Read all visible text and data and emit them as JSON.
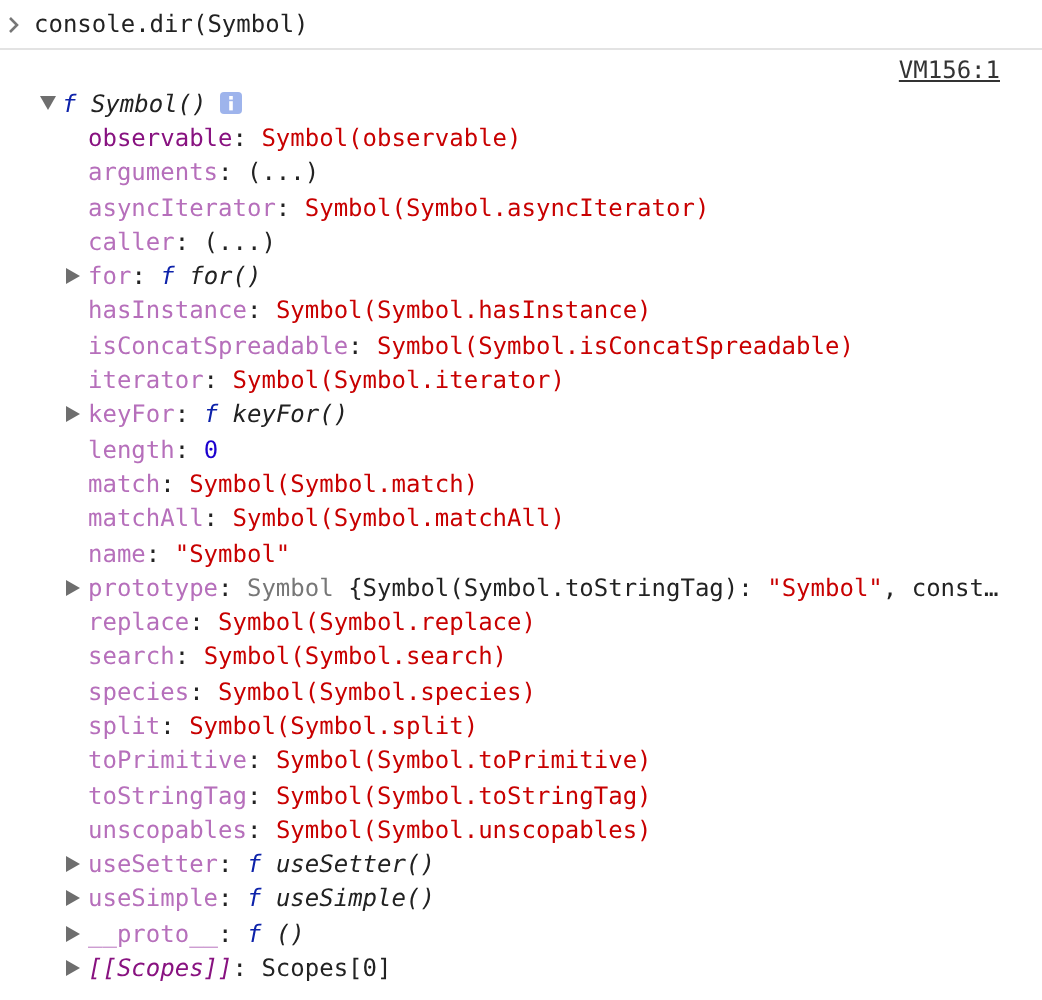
{
  "input": {
    "command": "console.dir(Symbol)"
  },
  "output": {
    "source": "VM156:1",
    "root": {
      "expanded": true,
      "parts": [
        {
          "kind": "fn-keyword",
          "text": "f"
        },
        {
          "kind": "fn-name",
          "text": " Symbol()"
        }
      ]
    },
    "properties": [
      {
        "expandable": false,
        "parts": [
          {
            "kind": "key",
            "text": "observable"
          },
          {
            "kind": "punct",
            "text": ": "
          },
          {
            "kind": "symbol",
            "text": "Symbol(observable)"
          }
        ]
      },
      {
        "expandable": false,
        "parts": [
          {
            "kind": "key-dim",
            "text": "arguments"
          },
          {
            "kind": "punct",
            "text": ": (...)"
          }
        ]
      },
      {
        "expandable": false,
        "parts": [
          {
            "kind": "key-dim",
            "text": "asyncIterator"
          },
          {
            "kind": "punct",
            "text": ": "
          },
          {
            "kind": "symbol",
            "text": "Symbol(Symbol.asyncIterator)"
          }
        ]
      },
      {
        "expandable": false,
        "parts": [
          {
            "kind": "key-dim",
            "text": "caller"
          },
          {
            "kind": "punct",
            "text": ": (...)"
          }
        ]
      },
      {
        "expandable": true,
        "parts": [
          {
            "kind": "key-dim",
            "text": "for"
          },
          {
            "kind": "punct",
            "text": ": "
          },
          {
            "kind": "fn-keyword",
            "text": "f"
          },
          {
            "kind": "fn-name",
            "text": " for()"
          }
        ]
      },
      {
        "expandable": false,
        "parts": [
          {
            "kind": "key-dim",
            "text": "hasInstance"
          },
          {
            "kind": "punct",
            "text": ": "
          },
          {
            "kind": "symbol",
            "text": "Symbol(Symbol.hasInstance)"
          }
        ]
      },
      {
        "expandable": false,
        "parts": [
          {
            "kind": "key-dim",
            "text": "isConcatSpreadable"
          },
          {
            "kind": "punct",
            "text": ": "
          },
          {
            "kind": "symbol",
            "text": "Symbol(Symbol.isConcatSpreadable)"
          }
        ]
      },
      {
        "expandable": false,
        "parts": [
          {
            "kind": "key-dim",
            "text": "iterator"
          },
          {
            "kind": "punct",
            "text": ": "
          },
          {
            "kind": "symbol",
            "text": "Symbol(Symbol.iterator)"
          }
        ]
      },
      {
        "expandable": true,
        "parts": [
          {
            "kind": "key-dim",
            "text": "keyFor"
          },
          {
            "kind": "punct",
            "text": ": "
          },
          {
            "kind": "fn-keyword",
            "text": "f"
          },
          {
            "kind": "fn-name",
            "text": " keyFor()"
          }
        ]
      },
      {
        "expandable": false,
        "parts": [
          {
            "kind": "key-dim",
            "text": "length"
          },
          {
            "kind": "punct",
            "text": ": "
          },
          {
            "kind": "number",
            "text": "0"
          }
        ]
      },
      {
        "expandable": false,
        "parts": [
          {
            "kind": "key-dim",
            "text": "match"
          },
          {
            "kind": "punct",
            "text": ": "
          },
          {
            "kind": "symbol",
            "text": "Symbol(Symbol.match)"
          }
        ]
      },
      {
        "expandable": false,
        "parts": [
          {
            "kind": "key-dim",
            "text": "matchAll"
          },
          {
            "kind": "punct",
            "text": ": "
          },
          {
            "kind": "symbol",
            "text": "Symbol(Symbol.matchAll)"
          }
        ]
      },
      {
        "expandable": false,
        "parts": [
          {
            "kind": "key-dim",
            "text": "name"
          },
          {
            "kind": "punct",
            "text": ": "
          },
          {
            "kind": "string",
            "text": "\"Symbol\""
          }
        ]
      },
      {
        "expandable": true,
        "parts": [
          {
            "kind": "key-dim",
            "text": "prototype"
          },
          {
            "kind": "punct",
            "text": ": "
          },
          {
            "kind": "class",
            "text": "Symbol"
          },
          {
            "kind": "punct",
            "text": " {Symbol(Symbol.toStringTag): "
          },
          {
            "kind": "string",
            "text": "\"Symbol\""
          },
          {
            "kind": "punct",
            "text": ", const…"
          }
        ]
      },
      {
        "expandable": false,
        "parts": [
          {
            "kind": "key-dim",
            "text": "replace"
          },
          {
            "kind": "punct",
            "text": ": "
          },
          {
            "kind": "symbol",
            "text": "Symbol(Symbol.replace)"
          }
        ]
      },
      {
        "expandable": false,
        "parts": [
          {
            "kind": "key-dim",
            "text": "search"
          },
          {
            "kind": "punct",
            "text": ": "
          },
          {
            "kind": "symbol",
            "text": "Symbol(Symbol.search)"
          }
        ]
      },
      {
        "expandable": false,
        "parts": [
          {
            "kind": "key-dim",
            "text": "species"
          },
          {
            "kind": "punct",
            "text": ": "
          },
          {
            "kind": "symbol",
            "text": "Symbol(Symbol.species)"
          }
        ]
      },
      {
        "expandable": false,
        "parts": [
          {
            "kind": "key-dim",
            "text": "split"
          },
          {
            "kind": "punct",
            "text": ": "
          },
          {
            "kind": "symbol",
            "text": "Symbol(Symbol.split)"
          }
        ]
      },
      {
        "expandable": false,
        "parts": [
          {
            "kind": "key-dim",
            "text": "toPrimitive"
          },
          {
            "kind": "punct",
            "text": ": "
          },
          {
            "kind": "symbol",
            "text": "Symbol(Symbol.toPrimitive)"
          }
        ]
      },
      {
        "expandable": false,
        "parts": [
          {
            "kind": "key-dim",
            "text": "toStringTag"
          },
          {
            "kind": "punct",
            "text": ": "
          },
          {
            "kind": "symbol",
            "text": "Symbol(Symbol.toStringTag)"
          }
        ]
      },
      {
        "expandable": false,
        "parts": [
          {
            "kind": "key-dim",
            "text": "unscopables"
          },
          {
            "kind": "punct",
            "text": ": "
          },
          {
            "kind": "symbol",
            "text": "Symbol(Symbol.unscopables)"
          }
        ]
      },
      {
        "expandable": true,
        "parts": [
          {
            "kind": "key-dim",
            "text": "useSetter"
          },
          {
            "kind": "punct",
            "text": ": "
          },
          {
            "kind": "fn-keyword",
            "text": "f"
          },
          {
            "kind": "fn-name",
            "text": " useSetter()"
          }
        ]
      },
      {
        "expandable": true,
        "parts": [
          {
            "kind": "key-dim",
            "text": "useSimple"
          },
          {
            "kind": "punct",
            "text": ": "
          },
          {
            "kind": "fn-keyword",
            "text": "f"
          },
          {
            "kind": "fn-name",
            "text": " useSimple()"
          }
        ]
      },
      {
        "expandable": true,
        "parts": [
          {
            "kind": "key-dim",
            "text": "__proto__"
          },
          {
            "kind": "punct",
            "text": ": "
          },
          {
            "kind": "fn-keyword",
            "text": "f"
          },
          {
            "kind": "fn-name",
            "text": " ()"
          }
        ]
      },
      {
        "expandable": true,
        "parts": [
          {
            "kind": "key-internal",
            "text": "[[Scopes]]"
          },
          {
            "kind": "punct",
            "text": ": Scopes[0]"
          }
        ]
      }
    ]
  }
}
